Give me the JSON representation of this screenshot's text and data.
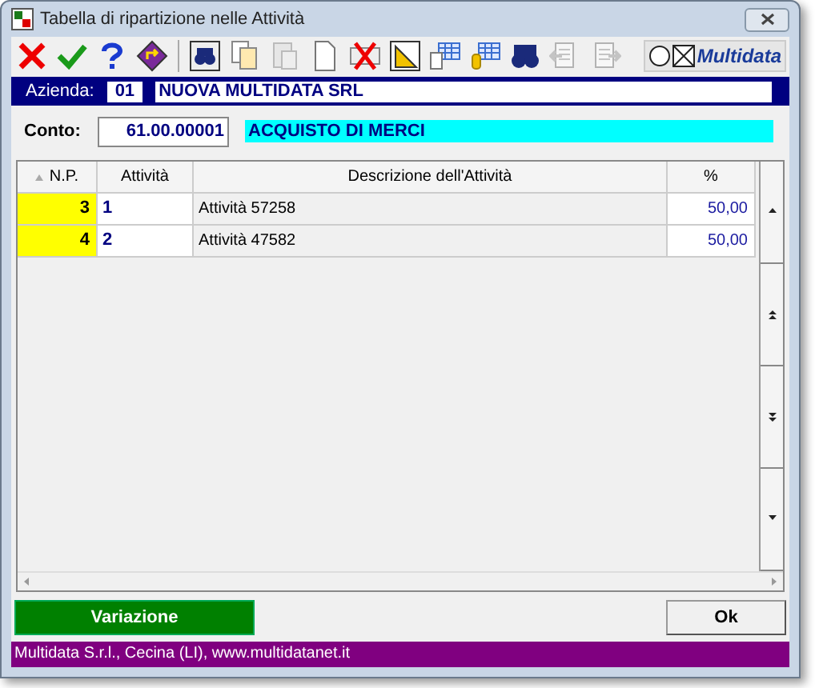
{
  "window": {
    "title": "Tabella di ripartizione nelle Attività"
  },
  "toolbar": [
    {
      "kind": "cancel",
      "disabled": false
    },
    {
      "kind": "confirm",
      "disabled": false
    },
    {
      "kind": "help",
      "disabled": false
    },
    {
      "kind": "exit",
      "disabled": false
    },
    {
      "kind": "find",
      "disabled": false
    },
    {
      "kind": "copy",
      "disabled": false
    },
    {
      "kind": "paste",
      "disabled": true
    },
    {
      "kind": "new",
      "disabled": false
    },
    {
      "kind": "delete",
      "disabled": false
    },
    {
      "kind": "ruler",
      "disabled": false
    },
    {
      "kind": "table",
      "disabled": false
    },
    {
      "kind": "tabledb",
      "disabled": false
    },
    {
      "kind": "binoculars",
      "disabled": false
    },
    {
      "kind": "import",
      "disabled": true
    },
    {
      "kind": "export",
      "disabled": true
    }
  ],
  "logo": {
    "text": "Multidata"
  },
  "azienda": {
    "label": "Azienda:",
    "code": "01",
    "name": "NUOVA MULTIDATA SRL"
  },
  "conto": {
    "label": "Conto:",
    "code": "61.00.00001",
    "description": "ACQUISTO DI MERCI"
  },
  "table": {
    "columns": [
      "N.P.",
      "Attività",
      "Descrizione dell'Attività",
      "%"
    ],
    "rows": [
      {
        "np": "3",
        "activity": "1",
        "description": "Attività 57258",
        "percent": "50,00"
      },
      {
        "np": "4",
        "activity": "2",
        "description": "Attività 47582",
        "percent": "50,00"
      }
    ]
  },
  "buttons": {
    "left": "Variazione",
    "right": "Ok"
  },
  "status_bar": "Multidata S.r.l., Cecina (LI), www.multidatanet.it"
}
